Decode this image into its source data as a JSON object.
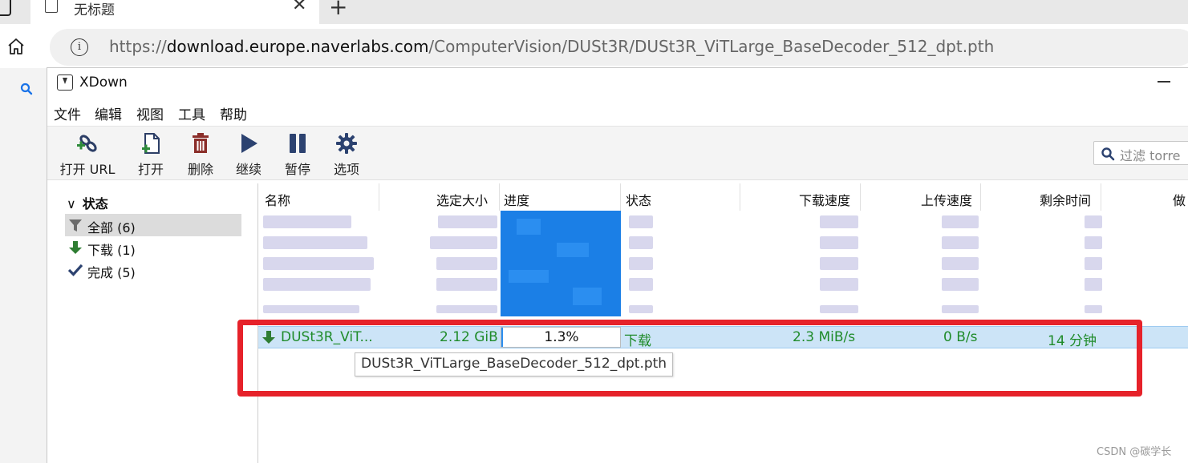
{
  "browser": {
    "tab_title": "无标题",
    "url_prefix": "https://",
    "url_host": "download.europe.naverlabs.com",
    "url_path": "/ComputerVision/DUSt3R/DUSt3R_ViTLarge_BaseDecoder_512_dpt.pth"
  },
  "app": {
    "title": "XDown",
    "menu": [
      "文件",
      "编辑",
      "视图",
      "工具",
      "帮助"
    ],
    "toolbar": [
      {
        "label": "打开 URL",
        "icon": "link-add-icon"
      },
      {
        "label": "打开",
        "icon": "file-add-icon"
      },
      {
        "label": "删除",
        "icon": "trash-icon"
      },
      {
        "label": "继续",
        "icon": "play-icon"
      },
      {
        "label": "暂停",
        "icon": "pause-icon"
      },
      {
        "label": "选项",
        "icon": "gear-icon"
      }
    ],
    "filter_placeholder": "过滤 torre"
  },
  "status_panel": {
    "header": "状态",
    "items": [
      {
        "label": "全部 (6)",
        "icon": "filter-icon",
        "selected": true
      },
      {
        "label": "下载 (1)",
        "icon": "download-arrow-icon",
        "selected": false
      },
      {
        "label": "完成 (5)",
        "icon": "check-icon",
        "selected": false
      }
    ]
  },
  "table": {
    "columns": [
      "名称",
      "选定大小",
      "进度",
      "状态",
      "下载速度",
      "上传速度",
      "剩余时间",
      "做"
    ],
    "selected_row": {
      "name": "DUSt3R_ViT...",
      "size": "2.12 GiB",
      "progress_text": "1.3%",
      "progress": 0.013,
      "status": "下载",
      "down_speed": "2.3 MiB/s",
      "up_speed": "0 B/s",
      "eta": "14 分钟"
    },
    "tooltip": "DUSt3R_ViTLarge_BaseDecoder_512_dpt.pth"
  },
  "colors": {
    "accent_green": "#1f8b2a",
    "highlight_red": "#e6222a",
    "selection_blue": "#cce4f7"
  },
  "watermark": "CSDN @碳学长"
}
